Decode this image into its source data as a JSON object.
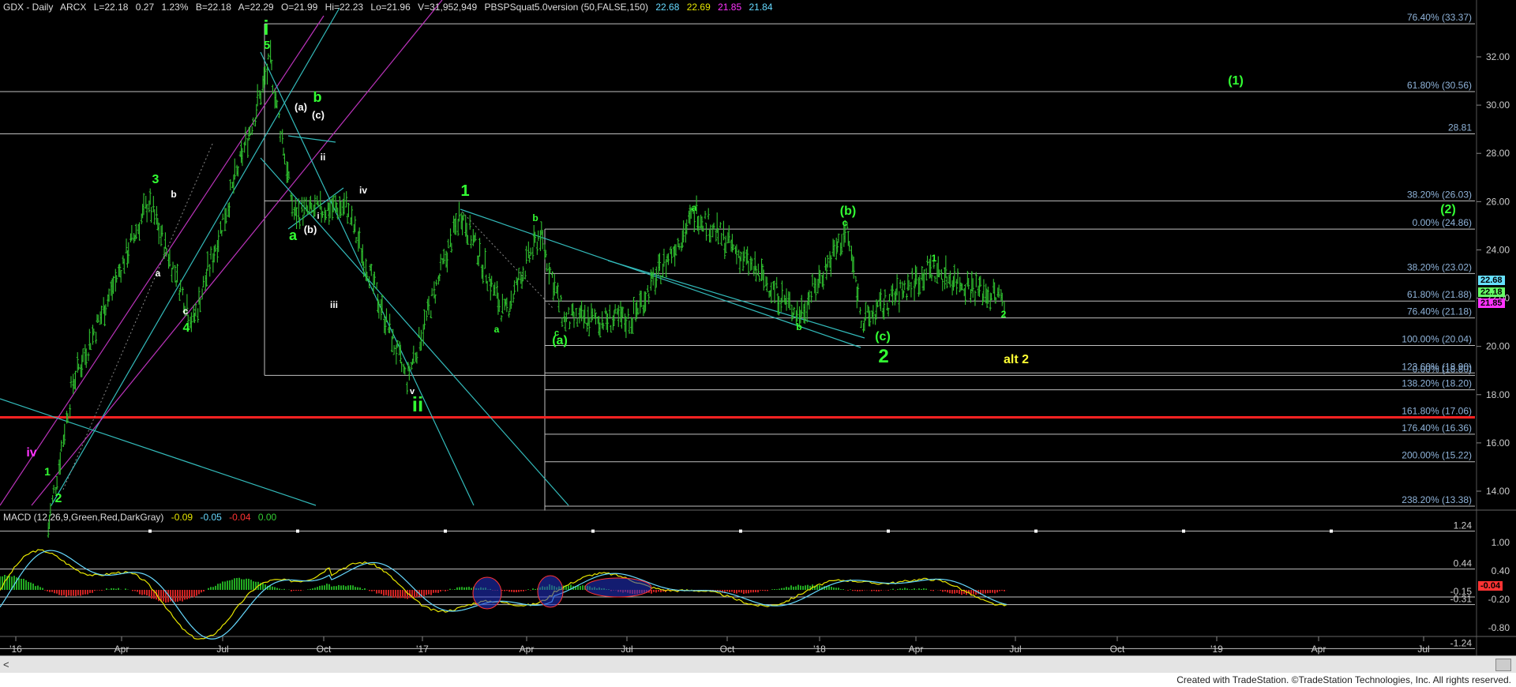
{
  "header": {
    "symbol": "GDX - Daily",
    "exchange": "ARCX",
    "last": "L=22.18",
    "change": "0.27",
    "pct": "1.23%",
    "bid": "B=22.18",
    "ask": "A=22.29",
    "open": "O=21.99",
    "high": "Hi=22.23",
    "low": "Lo=21.96",
    "volume": "V=31,952,949",
    "indicator": "PBSPSquat5.0version (50,FALSE,150)",
    "ind_values": [
      "22.68",
      "22.69",
      "21.85",
      "21.84"
    ],
    "ind_colors": [
      "#66d9ff",
      "#e6e600",
      "#ff33ff",
      "#66d9ff"
    ]
  },
  "macd_header": {
    "label": "MACD (12,26,9,Green,Red,DarkGray)",
    "values": [
      "-0.09",
      "-0.05",
      "-0.04",
      "0.00"
    ],
    "colors": [
      "#e6e600",
      "#66d9ff",
      "#ff3333",
      "#33cc33"
    ]
  },
  "price_axis": [
    "32.00",
    "30.00",
    "28.00",
    "26.00",
    "24.00",
    "22.00",
    "20.00",
    "18.00",
    "16.00",
    "14.00"
  ],
  "macd_axis": [
    "1.00",
    "0.40",
    "-0.20",
    "-0.80"
  ],
  "macd_levels": [
    "1.24",
    "0.44",
    "-0.15",
    "-0.31",
    "-1.24"
  ],
  "price_tags": [
    {
      "text": "22.68",
      "bg": "#66e0ff"
    },
    {
      "text": "22.18",
      "bg": "#66ff66"
    },
    {
      "text": "21.85",
      "bg": "#ff33ff"
    }
  ],
  "macd_tag": {
    "text": "-0.04",
    "bg": "#ff3333"
  },
  "time_axis": [
    "'16",
    "Apr",
    "Jul",
    "Oct",
    "'17",
    "Apr",
    "Jul",
    "Oct",
    "'18",
    "Apr",
    "Jul",
    "Oct",
    "'19",
    "Apr",
    "Jul"
  ],
  "fib_levels": [
    {
      "label": "76.40% (33.37)",
      "value": 33.37
    },
    {
      "label": "61.80% (30.56)",
      "value": 30.56
    },
    {
      "label": "28.81",
      "value": 28.81
    },
    {
      "label": "38.20% (26.03)",
      "value": 26.03
    },
    {
      "label": "0.00% (24.86)",
      "value": 24.86
    },
    {
      "label": "38.20% (23.02)",
      "value": 23.02
    },
    {
      "label": "61.80% (21.88)",
      "value": 21.88
    },
    {
      "label": "76.40% (21.18)",
      "value": 21.18
    },
    {
      "label": "100.00% (20.04)",
      "value": 20.04
    },
    {
      "label": "123.60% (18.90)",
      "value": 18.9
    },
    {
      "label": "0.00% (18.80)",
      "value": 18.8
    },
    {
      "label": "138.20% (18.20)",
      "value": 18.2
    },
    {
      "label": "161.80% (17.06)",
      "value": 17.06
    },
    {
      "label": "176.40% (16.36)",
      "value": 16.36
    },
    {
      "label": "200.00% (15.22)",
      "value": 15.22
    },
    {
      "label": "238.20% (13.38)",
      "value": 13.38
    }
  ],
  "wave_labels": [
    {
      "text": "i",
      "color": "#33ff33"
    },
    {
      "text": "5",
      "color": "#33ff33"
    },
    {
      "text": "3",
      "color": "#33ff33"
    },
    {
      "text": "b",
      "color": "#ffffff"
    },
    {
      "text": "a",
      "color": "#ffffff"
    },
    {
      "text": "c",
      "color": "#ffffff"
    },
    {
      "text": "4",
      "color": "#33ff33"
    },
    {
      "text": "iv",
      "color": "#ff33ff"
    },
    {
      "text": "1",
      "color": "#33ff33"
    },
    {
      "text": "2",
      "color": "#33ff33"
    },
    {
      "text": "(a)",
      "color": "#ffffff"
    },
    {
      "text": "b",
      "color": "#33ff33"
    },
    {
      "text": "(c)",
      "color": "#ffffff"
    },
    {
      "text": "ii",
      "color": "#ffffff"
    },
    {
      "text": "iv",
      "color": "#ffffff"
    },
    {
      "text": "a",
      "color": "#33ff33"
    },
    {
      "text": "(b)",
      "color": "#ffffff"
    },
    {
      "text": "i",
      "color": "#ffffff"
    },
    {
      "text": "iii",
      "color": "#ffffff"
    },
    {
      "text": "v",
      "color": "#ffffff"
    },
    {
      "text": "ii",
      "color": "#33ff33"
    },
    {
      "text": "1",
      "color": "#33ff33"
    },
    {
      "text": "b",
      "color": "#33ff33"
    },
    {
      "text": "a",
      "color": "#33ff33"
    },
    {
      "text": "c",
      "color": "#33ff33"
    },
    {
      "text": "(a)",
      "color": "#33ff33"
    },
    {
      "text": "a",
      "color": "#33ff33"
    },
    {
      "text": "(b)",
      "color": "#33ff33"
    },
    {
      "text": "c",
      "color": "#33ff33"
    },
    {
      "text": "b",
      "color": "#33ff33"
    },
    {
      "text": "(c)",
      "color": "#33ff33"
    },
    {
      "text": "2",
      "color": "#33ff33"
    },
    {
      "text": "1",
      "color": "#33ff33"
    },
    {
      "text": "2",
      "color": "#33ff33"
    },
    {
      "text": "alt 2",
      "color": "#ffff33"
    },
    {
      "text": "(1)",
      "color": "#33ff33"
    },
    {
      "text": "(2)",
      "color": "#33ff33"
    }
  ],
  "footer": "Created with TradeStation. ©TradeStation Technologies, Inc. All rights reserved.",
  "scroll": {
    "left": "<",
    "right": ">"
  },
  "colors": {
    "background": "#000000",
    "bars": "#33cc33",
    "fib_lines": "#c0c0c0",
    "channel_cyan": "#33cccc",
    "channel_magenta": "#cc33cc",
    "red_line": "#ff2222"
  },
  "chart_data": {
    "type": "ohlc",
    "symbol": "GDX",
    "interval": "Daily",
    "ylim": [
      12.8,
      34.5
    ],
    "x_range": [
      "2015-12",
      "2019-08"
    ],
    "key_points": [
      {
        "date": "2016-01-19",
        "price": 12.4
      },
      {
        "date": "2016-02-11",
        "price": 18.5
      },
      {
        "date": "2016-04-21",
        "price": 26.0
      },
      {
        "date": "2016-06-01",
        "price": 21.0
      },
      {
        "date": "2016-08-11",
        "price": 31.8
      },
      {
        "date": "2016-09-02",
        "price": 25.5
      },
      {
        "date": "2016-10-20",
        "price": 25.8
      },
      {
        "date": "2016-12-15",
        "price": 18.6
      },
      {
        "date": "2017-02-03",
        "price": 25.6
      },
      {
        "date": "2017-03-15",
        "price": 21.3
      },
      {
        "date": "2017-04-17",
        "price": 24.7
      },
      {
        "date": "2017-05-09",
        "price": 21.1
      },
      {
        "date": "2017-07-10",
        "price": 21.1
      },
      {
        "date": "2017-09-08",
        "price": 25.6
      },
      {
        "date": "2017-12-12",
        "price": 21.3
      },
      {
        "date": "2018-01-25",
        "price": 24.8
      },
      {
        "date": "2018-02-09",
        "price": 21.0
      },
      {
        "date": "2018-04-11",
        "price": 23.2
      },
      {
        "date": "2018-06-19",
        "price": 21.96
      },
      {
        "date": "2018-06-21",
        "price": 22.18
      }
    ],
    "macd": {
      "macd": -0.09,
      "signal": -0.05,
      "histogram": -0.04
    }
  }
}
